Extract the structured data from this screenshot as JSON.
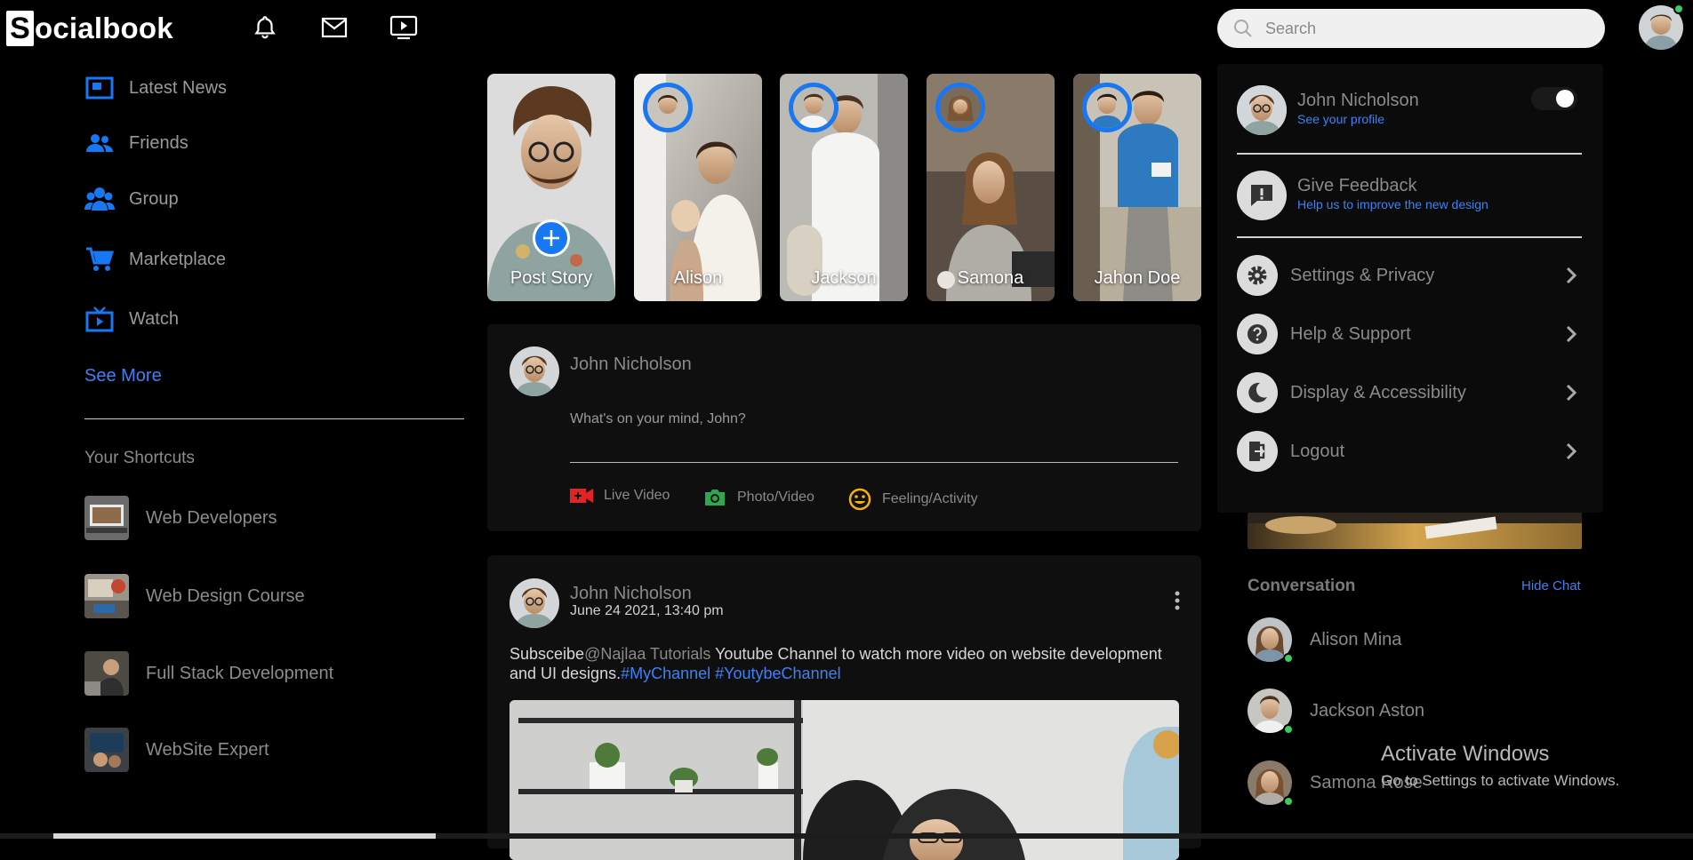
{
  "nav": {
    "logo_letter": "S",
    "logo_rest": "ocialbook",
    "search_placeholder": "Search",
    "icons": [
      "bell-icon",
      "mail-icon",
      "video-play-icon"
    ]
  },
  "sidebar": {
    "items": [
      {
        "label": "Latest News",
        "icon": "news-icon"
      },
      {
        "label": "Friends",
        "icon": "friends-icon"
      },
      {
        "label": "Group",
        "icon": "group-icon"
      },
      {
        "label": "Marketplace",
        "icon": "cart-icon"
      },
      {
        "label": "Watch",
        "icon": "tv-icon"
      }
    ],
    "see_more": "See More",
    "shortcuts_title": "Your Shortcuts",
    "shortcuts": [
      {
        "label": "Web Developers"
      },
      {
        "label": "Web Design Course"
      },
      {
        "label": "Full Stack Development"
      },
      {
        "label": "WebSite Expert"
      }
    ]
  },
  "stories": [
    {
      "name": "Post Story"
    },
    {
      "name": "Alison"
    },
    {
      "name": "Jackson"
    },
    {
      "name": "Samona"
    },
    {
      "name": "Jahon Doe"
    }
  ],
  "composer": {
    "name": "John Nicholson",
    "placeholder": "What's on your mind, John?",
    "actions": [
      {
        "label": "Live Video",
        "icon": "live-video-icon",
        "color": "#e02424"
      },
      {
        "label": "Photo/Video",
        "icon": "camera-icon",
        "color": "#2ea84f"
      },
      {
        "label": "Feeling/Activity",
        "icon": "smiley-icon",
        "color": "#f4b400"
      }
    ]
  },
  "post": {
    "name": "John Nicholson",
    "date": "June 24 2021, 13:40 pm",
    "text_before": "Subsceibe",
    "mention": "@Najlaa Tutorials",
    "text_after": " Youtube Channel to watch more video on website development and UI designs.",
    "tag1": "#MyChannel",
    "tag2": " #YoutybeChannel"
  },
  "dropdown": {
    "profile_name": "John Nicholson",
    "profile_sub": "See your profile",
    "feedback_title": "Give Feedback",
    "feedback_sub": "Help us to improve the new design",
    "menu": [
      {
        "label": "Settings & Privacy",
        "icon": "gear-icon"
      },
      {
        "label": "Help & Support",
        "icon": "question-icon"
      },
      {
        "label": "Display & Accessibility",
        "icon": "moon-icon"
      },
      {
        "label": "Logout",
        "icon": "logout-icon"
      }
    ]
  },
  "conversation": {
    "title": "Conversation",
    "hide_chat": "Hide Chat",
    "contacts": [
      {
        "name": "Alison Mina"
      },
      {
        "name": "Jackson Aston"
      },
      {
        "name": "Samona Rose"
      }
    ]
  },
  "os_watermark": {
    "title": "Activate Windows",
    "subtitle": "Go to Settings to activate Windows."
  },
  "colors": {
    "accent": "#1877f2",
    "link": "#3b82f6",
    "online": "#3bcc5c"
  }
}
